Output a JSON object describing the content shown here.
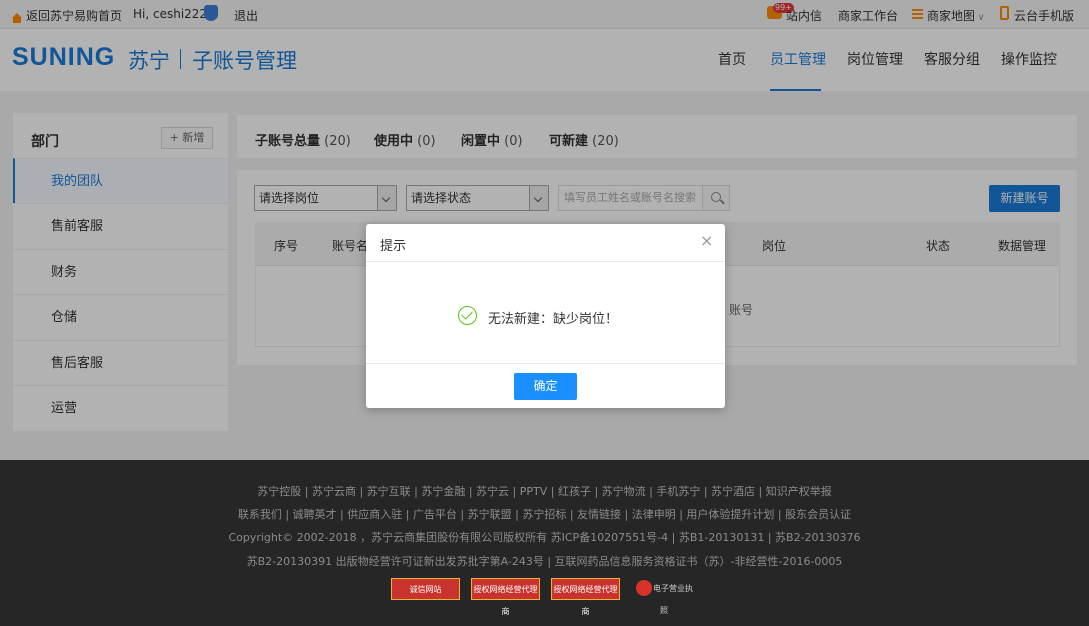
{
  "topbar": {
    "home_link": "返回苏宁易购首页",
    "greeting": "Hi, ceshi222...",
    "logout": "退出",
    "messages": "站内信",
    "message_badge": "99+",
    "workbench": "商家工作台",
    "merchant_map": "商家地图",
    "mobile_version": "云台手机版"
  },
  "header": {
    "logo_en": "SUNING",
    "logo_cn": "苏宁",
    "subtitle": "子账号管理",
    "nav": [
      "首页",
      "员工管理",
      "岗位管理",
      "客服分组",
      "操作监控"
    ],
    "active_nav": "员工管理"
  },
  "sidebar": {
    "title": "部门",
    "add_label": "+ 新增",
    "items": [
      "我的团队",
      "售前客服",
      "财务",
      "仓储",
      "售后客服",
      "运营"
    ]
  },
  "stats": {
    "total_label": "子账号总量",
    "total_value": "(20)",
    "active_label": "使用中",
    "active_value": "(0)",
    "idle_label": "闲置中",
    "idle_value": "(0)",
    "creatable_label": "可新建",
    "creatable_value": "(20)"
  },
  "filters": {
    "position_select": "请选择岗位",
    "status_select": "请选择状态",
    "search_placeholder": "填写员工姓名或账号名搜索",
    "new_account_button": "新建账号"
  },
  "table": {
    "headers": [
      "序号",
      "账号名",
      "岗位",
      "状态",
      "数据管理"
    ],
    "empty_text": "账号"
  },
  "modal": {
    "title": "提示",
    "close": "×",
    "message": "无法新建：缺少岗位！",
    "ok_button": "确定"
  },
  "footer": {
    "links_row1": "苏宁控股 | 苏宁云商 | 苏宁互联 | 苏宁金融 | 苏宁云 | PPTV | 红孩子 | 苏宁物流 | 手机苏宁 | 苏宁酒店 | 知识产权举报",
    "links_row2": "联系我们 | 诚聘英才 | 供应商入驻 | 广告平台 | 苏宁联盟 | 苏宁招标 | 友情链接 | 法律申明 | 用户体验提升计划 | 股东会员认证",
    "copyright": "Copyright© 2002-2018 ，苏宁云商集团股份有限公司版权所有 苏ICP备10207551号-4 | 苏B1-20130131 | 苏B2-20130376",
    "license": "苏B2-20130391 出版物经营许可证新出发苏批字第A-243号 | 互联网药品信息服务资格证书（苏）-非经营性-2016-0005",
    "badges": [
      "诚信网站",
      "授权网络经营代理商",
      "授权网络经营代理商",
      "电子营业执照"
    ]
  },
  "colors": {
    "brand_blue": "#1a7bd8",
    "accent_orange": "#ff8a00",
    "success_green": "#52c41a",
    "footer_bg": "#262626"
  }
}
